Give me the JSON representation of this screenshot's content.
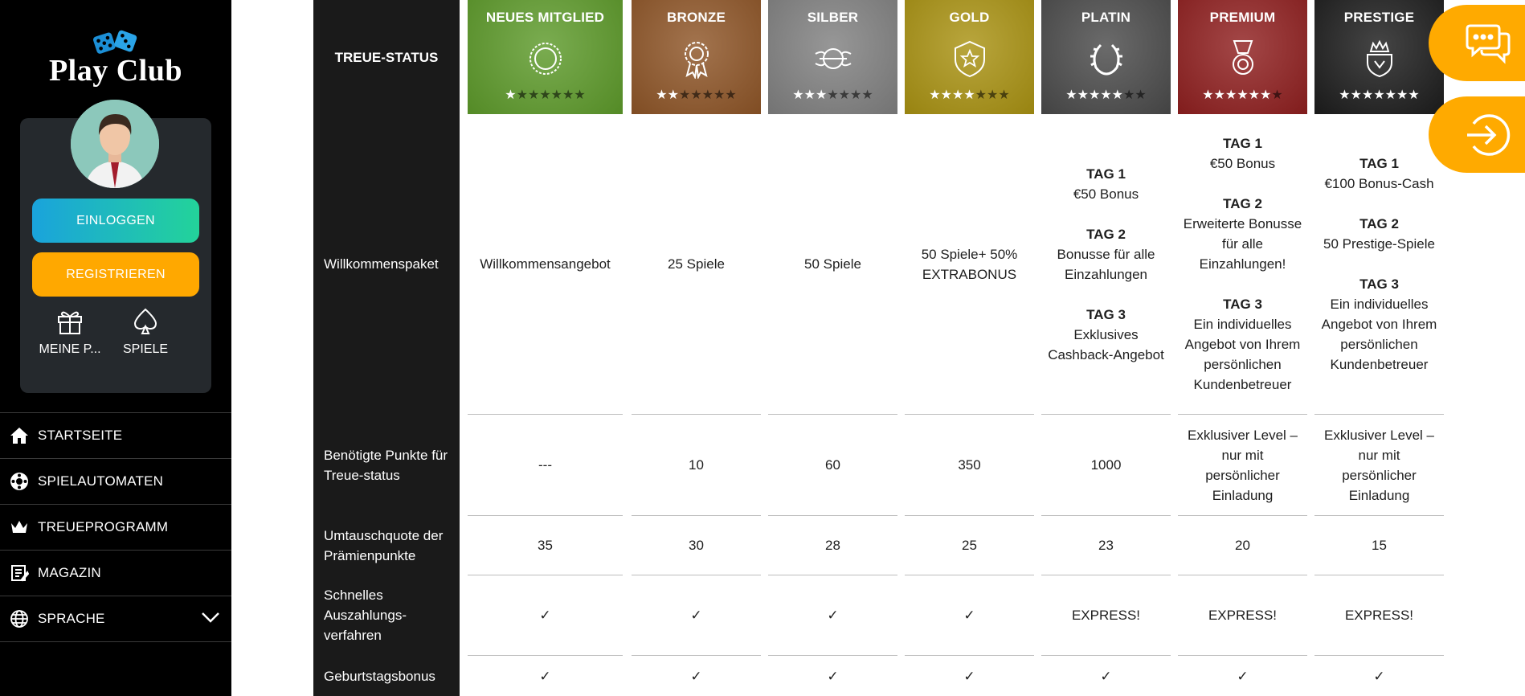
{
  "sidebar": {
    "logo_text": "Play Club",
    "login_label": "EINLOGGEN",
    "register_label": "REGISTRIEREN",
    "quick_links": [
      {
        "label": "MEINE P...",
        "icon": "gift-icon"
      },
      {
        "label": "SPIELE",
        "icon": "spade-icon"
      }
    ],
    "nav": [
      {
        "label": "STARTSEITE",
        "icon": "home-icon"
      },
      {
        "label": "SPIELAUTOMATEN",
        "icon": "roulette-icon"
      },
      {
        "label": "TREUEPROGRAMM",
        "icon": "crown-icon"
      },
      {
        "label": "MAGAZIN",
        "icon": "magazine-icon"
      },
      {
        "label": "SPRACHE",
        "icon": "globe-icon"
      }
    ]
  },
  "table": {
    "header_label": "TREUE-STATUS",
    "row_labels": {
      "welcome": "Willkommenspaket",
      "points": "Benötigte Punkte für Treue-status",
      "rate": "Umtauschquote der Prämienpunkte",
      "payout": "Schnelles Auszahlungs-verfahren",
      "birthday": "Geburtstagsbonus"
    },
    "tiers": [
      {
        "name": "NEUES MITGLIED",
        "color": "#5d9a2a",
        "stars_filled": 1,
        "badge": "ring-badge-icon",
        "welcome": [
          {
            "t": "Willkommensangebot"
          }
        ],
        "points": "---",
        "rate": "35",
        "payout": "✓",
        "birthday": "✓"
      },
      {
        "name": "BRONZE",
        "color": "#8e5527",
        "stars_filled": 2,
        "badge": "rosette-badge-icon",
        "welcome": [
          {
            "t": "25 Spiele"
          }
        ],
        "points": "10",
        "rate": "30",
        "payout": "✓",
        "birthday": "✓"
      },
      {
        "name": "SILBER",
        "color": "#808080",
        "stars_filled": 3,
        "badge": "winged-badge-icon",
        "welcome": [
          {
            "t": "50 Spiele"
          }
        ],
        "points": "60",
        "rate": "28",
        "payout": "✓",
        "birthday": "✓"
      },
      {
        "name": "GOLD",
        "color": "#a99212",
        "stars_filled": 4,
        "badge": "shield-star-badge-icon",
        "welcome": [
          {
            "t": "50 Spiele+ 50% EXTRABONUS"
          }
        ],
        "points": "350",
        "rate": "25",
        "payout": "✓",
        "birthday": "✓"
      },
      {
        "name": "PLATIN",
        "color": "#4a4a4a",
        "stars_filled": 5,
        "badge": "laurel-badge-icon",
        "welcome": [
          {
            "t": "TAG 1",
            "b": true
          },
          {
            "t": "€50 Bonus"
          },
          {
            "t": ""
          },
          {
            "t": "TAG 2",
            "b": true
          },
          {
            "t": "Bonusse für alle Einzahlungen"
          },
          {
            "t": ""
          },
          {
            "t": "TAG 3",
            "b": true
          },
          {
            "t": "Exklusives Cashback-Angebot"
          }
        ],
        "points": "1000",
        "rate": "23",
        "payout": "EXPRESS!",
        "birthday": "✓"
      },
      {
        "name": "PREMIUM",
        "color": "#8f1f1f",
        "stars_filled": 6,
        "badge": "medal-badge-icon",
        "welcome": [
          {
            "t": "TAG 1",
            "b": true
          },
          {
            "t": "€50 Bonus"
          },
          {
            "t": ""
          },
          {
            "t": "TAG 2",
            "b": true
          },
          {
            "t": "Erweiterte Bonusse für alle Einzahlungen!"
          },
          {
            "t": ""
          },
          {
            "t": "TAG 3",
            "b": true
          },
          {
            "t": "Ein individuelles Angebot von Ihrem persönlichen Kundenbetreuer"
          }
        ],
        "points": "Exklusiver Level – nur mit persönlicher Einladung",
        "rate": "20",
        "payout": "EXPRESS!",
        "birthday": "✓"
      },
      {
        "name": "PRESTIGE",
        "color": "#1c1c1c",
        "stars_filled": 7,
        "badge": "crown-shield-badge-icon",
        "welcome": [
          {
            "t": "TAG 1",
            "b": true
          },
          {
            "t": "€100 Bonus-Cash"
          },
          {
            "t": ""
          },
          {
            "t": "TAG 2",
            "b": true
          },
          {
            "t": "50 Prestige-Spiele"
          },
          {
            "t": ""
          },
          {
            "t": "TAG 3",
            "b": true
          },
          {
            "t": "Ein individuelles Angebot von Ihrem persönlichen Kundenbetreuer"
          }
        ],
        "points": "Exklusiver Level – nur mit persönlicher Einladung",
        "rate": "15",
        "payout": "EXPRESS!",
        "birthday": "✓"
      }
    ]
  },
  "floating": {
    "chat_icon": "chat-bubbles-icon",
    "login_icon": "sign-in-icon"
  }
}
